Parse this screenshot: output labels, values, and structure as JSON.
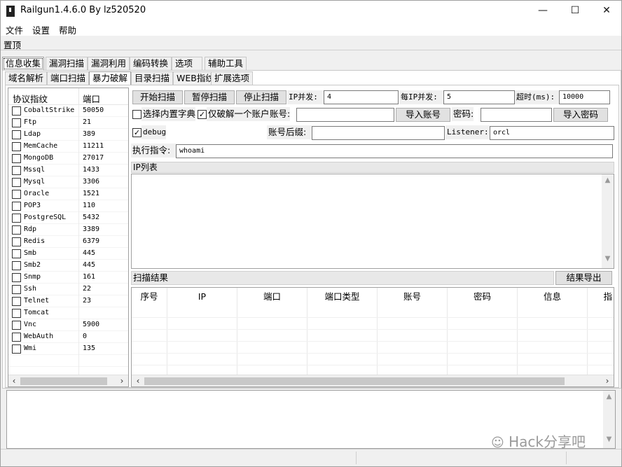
{
  "window": {
    "title": "Railgun1.4.6.0 By lz520520",
    "minimize": "—",
    "maximize": "☐",
    "close": "✕"
  },
  "menu": [
    "文件",
    "设置",
    "帮助"
  ],
  "toolbar": {
    "pin_label": "置顶"
  },
  "top_tabs": [
    "信息收集",
    "漏洞扫描",
    "漏洞利用",
    "编码转换",
    "选项",
    "辅助工具"
  ],
  "sub_tabs": [
    "域名解析",
    "端口扫描",
    "暴力破解",
    "目录扫描",
    "WEB指纹",
    "扩展选项"
  ],
  "protocol_list": {
    "col_protocol": "协议指纹",
    "col_port": "端口",
    "rows": [
      {
        "name": "CobaltStrike",
        "port": "50050"
      },
      {
        "name": "Ftp",
        "port": "21"
      },
      {
        "name": "Ldap",
        "port": "389"
      },
      {
        "name": "MemCache",
        "port": "11211"
      },
      {
        "name": "MongoDB",
        "port": "27017"
      },
      {
        "name": "Mssql",
        "port": "1433"
      },
      {
        "name": "Mysql",
        "port": "3306"
      },
      {
        "name": "Oracle",
        "port": "1521"
      },
      {
        "name": "POP3",
        "port": "110"
      },
      {
        "name": "PostgreSQL",
        "port": "5432"
      },
      {
        "name": "Rdp",
        "port": "3389"
      },
      {
        "name": "Redis",
        "port": "6379"
      },
      {
        "name": "Smb",
        "port": "445"
      },
      {
        "name": "Smb2",
        "port": "445"
      },
      {
        "name": "Snmp",
        "port": "161"
      },
      {
        "name": "Ssh",
        "port": "22"
      },
      {
        "name": "Telnet",
        "port": "23"
      },
      {
        "name": "Tomcat",
        "port": ""
      },
      {
        "name": "Vnc",
        "port": "5900"
      },
      {
        "name": "WebAuth",
        "port": "0"
      },
      {
        "name": "Wmi",
        "port": "135"
      }
    ]
  },
  "controls": {
    "start_scan": "开始扫描",
    "pause_scan": "暂停扫描",
    "stop_scan": "停止扫描",
    "ip_concurrency_label": "IP并发:",
    "ip_concurrency_value": "4",
    "per_ip_concurrency_label": "每IP并发:",
    "per_ip_concurrency_value": "5",
    "timeout_label": "超时(ms):",
    "timeout_value": "10000",
    "builtin_dict_label": "选择内置字典",
    "crack_one_label": "仅破解一个账户",
    "account_label": "账号:",
    "account_value": "",
    "import_account": "导入账号",
    "password_label": "密码:",
    "password_value": "",
    "import_password": "导入密码",
    "debug_label": "debug",
    "account_suffix_label": "账号后缀:",
    "account_suffix_value": "",
    "listener_label": "Listener:",
    "listener_value": "orcl",
    "exec_cmd_label": "执行指令:",
    "exec_cmd_value": "whoami"
  },
  "ip_list": {
    "title": "IP列表"
  },
  "results": {
    "title": "扫描结果",
    "export_button": "结果导出",
    "columns": [
      "序号",
      "IP",
      "端口",
      "端口类型",
      "账号",
      "密码",
      "信息",
      "指"
    ]
  },
  "watermark": "Hack分享吧"
}
